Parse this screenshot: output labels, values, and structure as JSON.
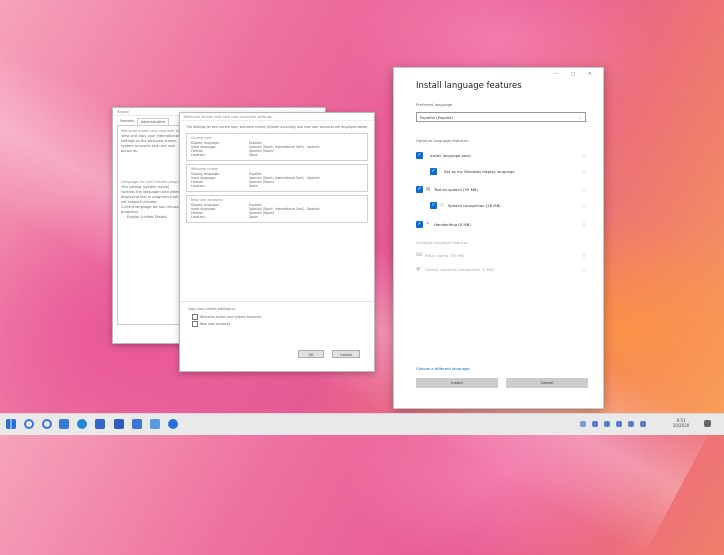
{
  "taskbar": {
    "pinned_icons": [
      "windows-start-icon",
      "search-icon",
      "cortana-icon",
      "task-view-icon",
      "edge-icon",
      "file-explorer-icon",
      "store-icon",
      "mail-icon",
      "photos-icon",
      "people-icon"
    ],
    "clock_time": "9:51",
    "clock_date": "10/2020"
  },
  "region_window": {
    "title": "Region",
    "tabs": [
      "Formats",
      "Administrative"
    ],
    "active_tab": "Administrative",
    "sections": [
      {
        "title": "Welcome screen and new user accounts",
        "body": "View and copy your international settings to the welcome screen, system accounts and new user accounts."
      },
      {
        "title": "Language for non-Unicode programs",
        "body": "This setting (system locale) controls the language used when displaying text in programs that do not support Unicode."
      },
      {
        "title": "",
        "body": "Current language for non-Unicode programs:"
      }
    ],
    "current_language": "English (United States)"
  },
  "welcome_window": {
    "title": "Welcome screen and new user accounts settings",
    "intro": "The settings for the current user, welcome screen (system accounts) and new user accounts are displayed below.",
    "groups": [
      {
        "title": "Current user",
        "rows": [
          {
            "k": "Display language:",
            "v": "Español"
          },
          {
            "k": "Input language:",
            "v": "Spanish (Spain, International Sort) - Spanish"
          },
          {
            "k": "Format:",
            "v": "Spanish (Spain)"
          },
          {
            "k": "Location:",
            "v": "Spain"
          }
        ]
      },
      {
        "title": "Welcome screen",
        "rows": [
          {
            "k": "Display language:",
            "v": "Español"
          },
          {
            "k": "Input language:",
            "v": "Spanish (Spain, International Sort) - Spanish"
          },
          {
            "k": "Format:",
            "v": "Spanish (Spain)"
          },
          {
            "k": "Location:",
            "v": "Spain"
          }
        ]
      },
      {
        "title": "New user accounts",
        "rows": [
          {
            "k": "Display language:",
            "v": "Español"
          },
          {
            "k": "Input language:",
            "v": "Spanish (Spain, International Sort) - Spanish"
          },
          {
            "k": "Format:",
            "v": "Spanish (Spain)"
          },
          {
            "k": "Location:",
            "v": "Spain"
          }
        ]
      }
    ],
    "copy_label": "Copy your current settings to:",
    "checkboxes": [
      {
        "label": "Welcome screen and system accounts",
        "checked": false
      },
      {
        "label": "New user accounts",
        "checked": false
      }
    ],
    "ok_label": "OK",
    "cancel_label": "Cancel"
  },
  "features": {
    "title": "Install language features",
    "preferred_label": "Preferred language",
    "dropdown_value": "Español (España)",
    "optional_label": "Optional language features",
    "options": [
      {
        "label": "Install language pack",
        "checked": true,
        "icon": "",
        "indent": false
      },
      {
        "label": "Set as my Windows display language",
        "checked": true,
        "icon": "",
        "indent": true
      },
      {
        "label": "Text-to-speech (35 MB)",
        "checked": true,
        "icon": "speech-icon",
        "indent": false
      },
      {
        "label": "Speech recognition (28 MB)",
        "checked": true,
        "icon": "microphone-icon",
        "indent": true
      },
      {
        "label": "Handwriting (8 MB)",
        "checked": true,
        "icon": "handwriting-icon",
        "indent": false
      }
    ],
    "installed_label": "Installed language features",
    "installed": [
      {
        "label": "Basic typing (36 MB)",
        "icon": "keyboard-icon"
      },
      {
        "label": "Optical character recognition (2 MB)",
        "icon": "ocr-icon"
      }
    ],
    "choose_link": "Choose a different language",
    "install_label": "Install",
    "cancel_label": "Cancel",
    "accent_color": "#0a6ed1"
  }
}
